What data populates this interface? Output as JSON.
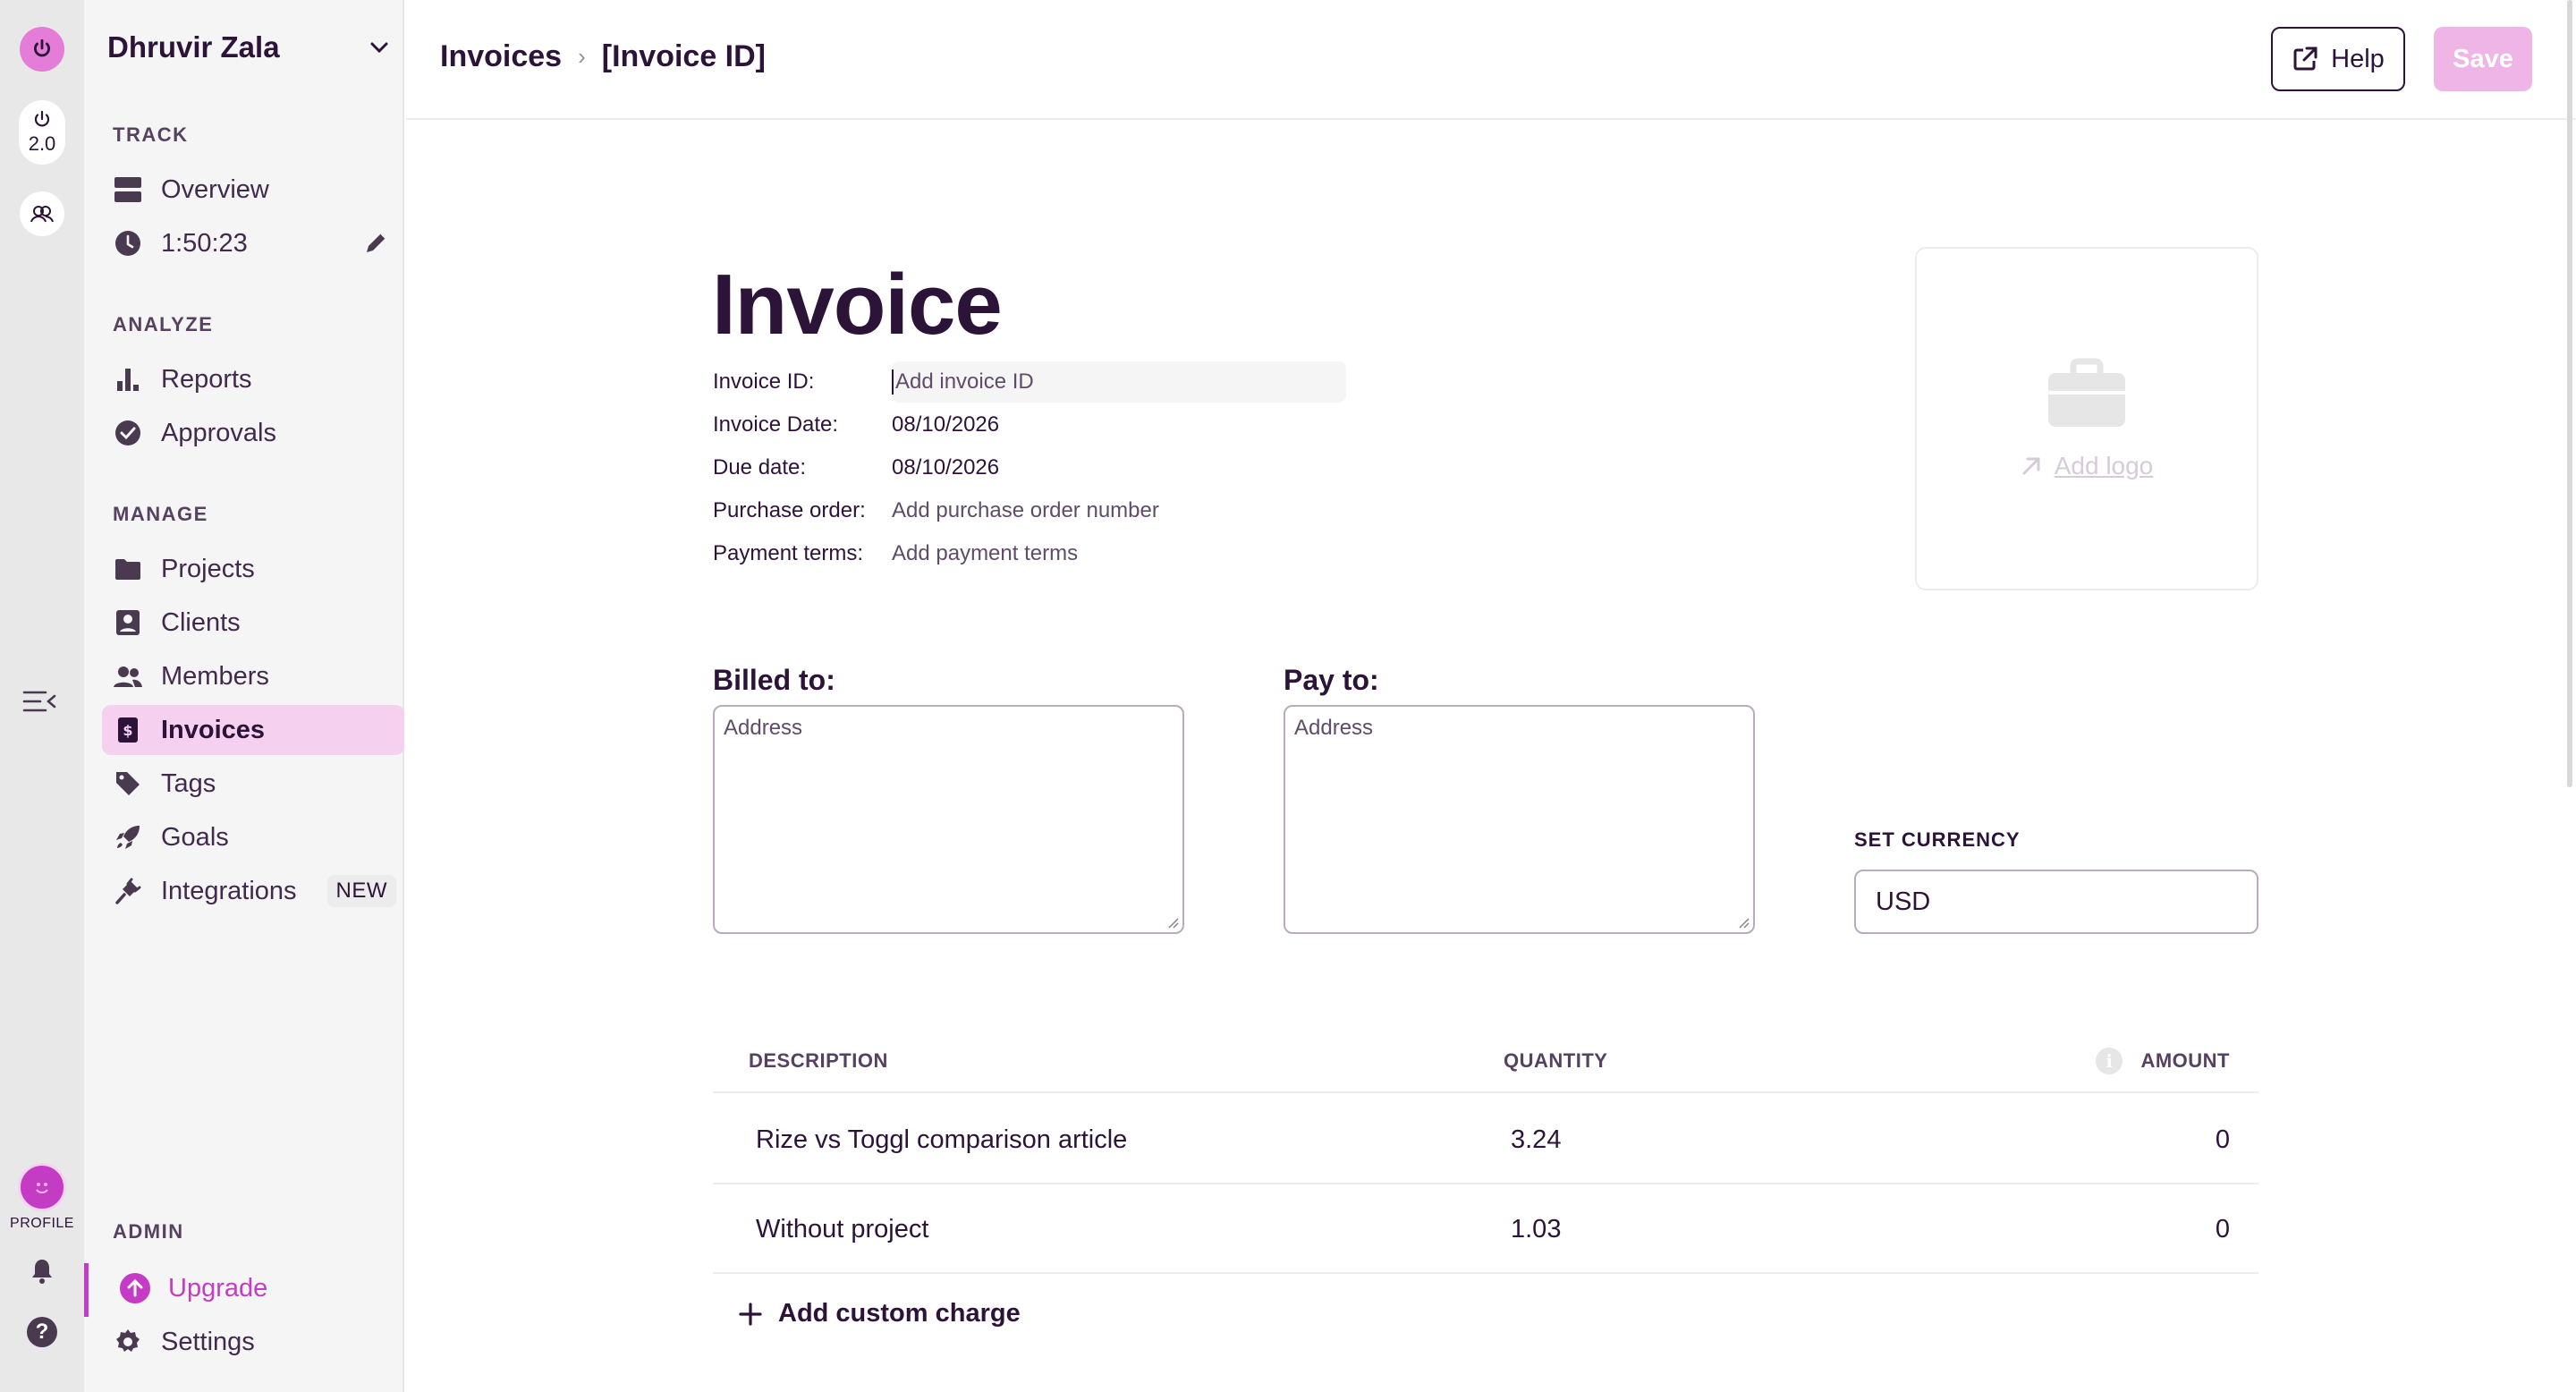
{
  "rail": {
    "version": "2.0",
    "profile_label": "PROFILE"
  },
  "sidebar": {
    "workspace": "Dhruvir Zala",
    "sections": {
      "track": "TRACK",
      "analyze": "ANALYZE",
      "manage": "MANAGE",
      "admin": "ADMIN"
    },
    "items": {
      "overview": "Overview",
      "timer": "1:50:23",
      "reports": "Reports",
      "approvals": "Approvals",
      "projects": "Projects",
      "clients": "Clients",
      "members": "Members",
      "invoices": "Invoices",
      "tags": "Tags",
      "goals": "Goals",
      "integrations": "Integrations",
      "integrations_badge": "NEW",
      "upgrade": "Upgrade",
      "settings": "Settings"
    },
    "colors": {
      "accent": "#c53cc4",
      "active_bg": "#f5d0ef"
    }
  },
  "header": {
    "breadcrumb_root": "Invoices",
    "breadcrumb_current": "[Invoice ID]",
    "help_label": "Help",
    "save_label": "Save"
  },
  "invoice": {
    "title": "Invoice",
    "fields": {
      "id_label": "Invoice ID:",
      "id_placeholder": "Add invoice ID",
      "date_label": "Invoice Date:",
      "date_value": "08/10/2026",
      "due_label": "Due date:",
      "due_value": "08/10/2026",
      "po_label": "Purchase order:",
      "po_placeholder": "Add purchase order number",
      "terms_label": "Payment terms:",
      "terms_placeholder": "Add payment terms"
    },
    "logo": {
      "add_label": "Add logo"
    },
    "billed_to": {
      "label": "Billed to:",
      "placeholder": "Address"
    },
    "pay_to": {
      "label": "Pay to:",
      "placeholder": "Address"
    },
    "currency": {
      "label": "SET CURRENCY",
      "value": "USD"
    },
    "table": {
      "headers": {
        "description": "DESCRIPTION",
        "quantity": "QUANTITY",
        "amount": "AMOUNT"
      },
      "rows": [
        {
          "description": "Rize vs Toggl comparison article",
          "quantity": "3.24",
          "amount": "0"
        },
        {
          "description": "Without project",
          "quantity": "1.03",
          "amount": "0"
        }
      ],
      "add_charge": "Add custom charge"
    }
  }
}
